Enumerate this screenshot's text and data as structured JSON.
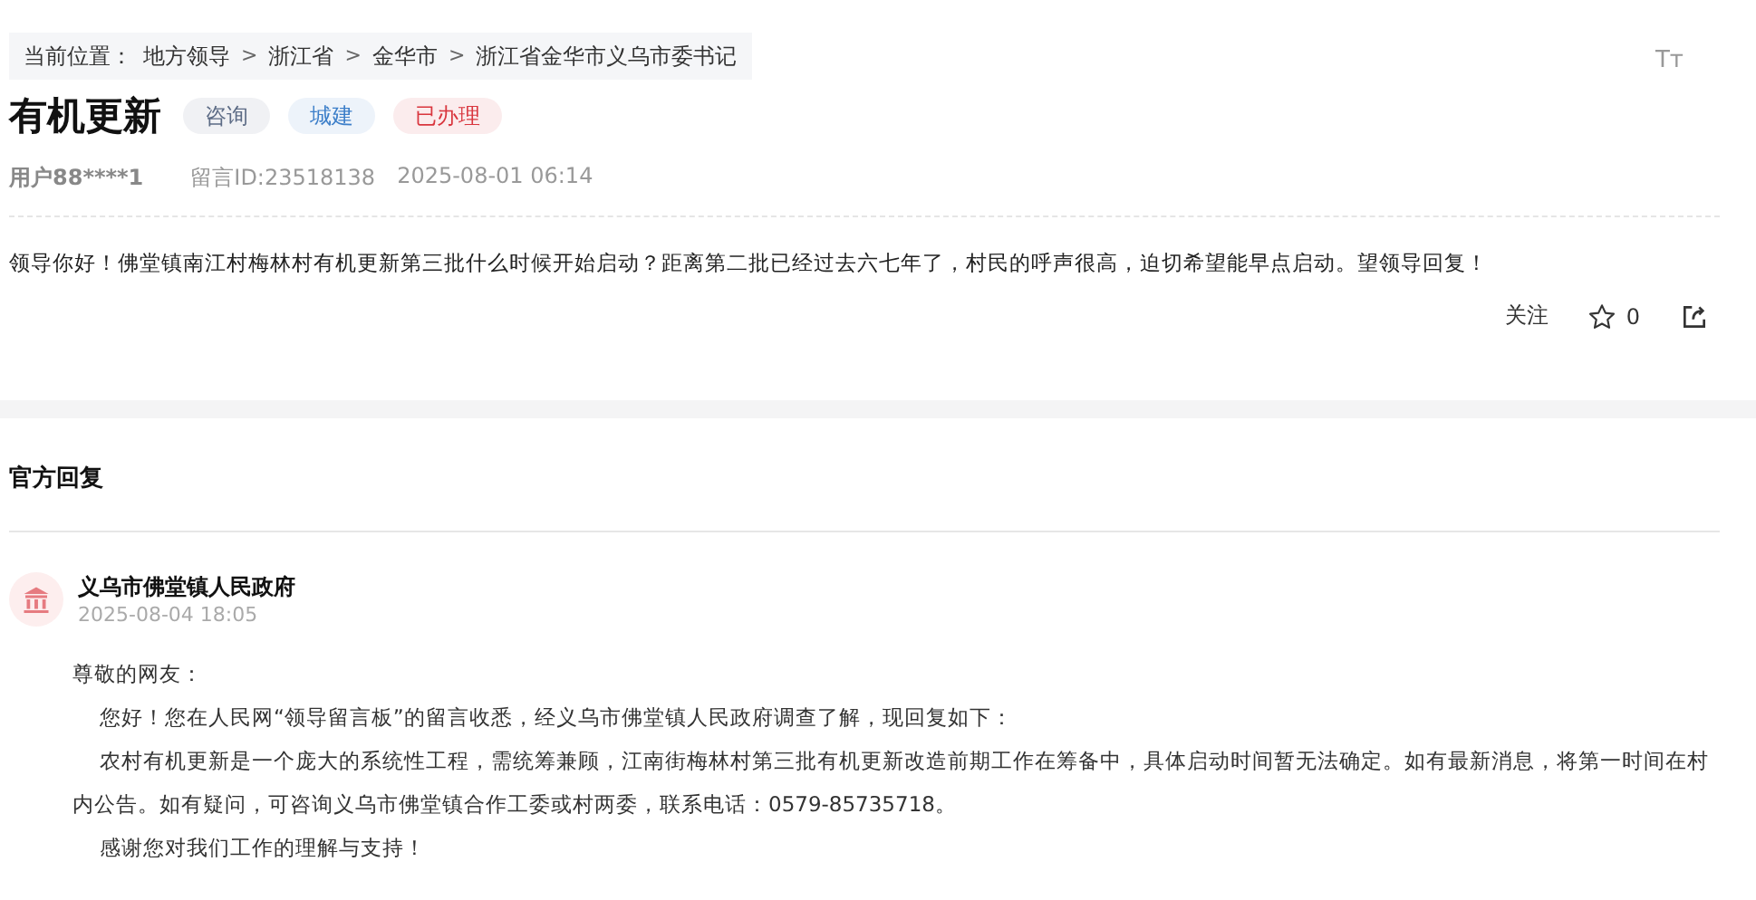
{
  "breadcrumb": {
    "label": "当前位置：",
    "separator": ">",
    "items": [
      "地方领导",
      "浙江省",
      "金华市",
      "浙江省金华市义乌市委书记"
    ]
  },
  "font_size_button": "Tт",
  "message": {
    "title": "有机更新",
    "tags": [
      {
        "text": "咨询",
        "color": "#5c6b85"
      },
      {
        "text": "城建",
        "color": "#3d7fc9"
      },
      {
        "text": "已办理",
        "color": "#d9363e"
      }
    ],
    "user": "用户88****1",
    "id": "留言ID:23518138",
    "time": "2025-08-01 06:14",
    "body": "领导你好！佛堂镇南江村梅林村有机更新第三批什么时候开始启动？距离第二批已经过去六七年了，村民的呼声很高，迫切希望能早点启动。望领导回复！",
    "follow": "关注",
    "likes": "0"
  },
  "reply": {
    "heading": "官方回复",
    "org": "义乌市佛堂镇人民政府",
    "time": "2025-08-04 18:05",
    "paragraphs": [
      {
        "kind": "greeting",
        "text": "尊敬的网友："
      },
      {
        "kind": "indent",
        "text": "您好！您在人民网“领导留言板”的留言收悉，经义乌市佛堂镇人民政府调查了解，现回复如下："
      },
      {
        "kind": "indent",
        "text": "农村有机更新是一个庞大的系统性工程，需统筹兼顾，江南街梅林村第三批有机更新改造前期工作在筹备中，具体启动时间暂无法确定。如有最新消息，将第一时间在村内公告。如有疑问，可咨询义乌市佛堂镇合作工委或村两委，联系电话：0579-85735718。"
      },
      {
        "kind": "indent",
        "text": "感谢您对我们工作的理解与支持！"
      }
    ]
  }
}
